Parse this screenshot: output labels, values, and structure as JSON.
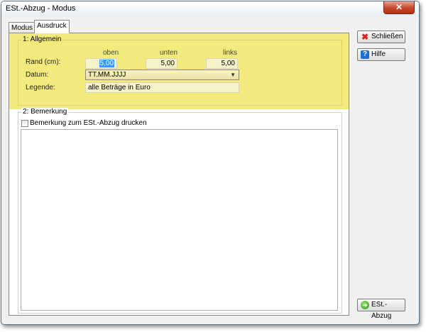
{
  "window": {
    "title": "ESt.-Abzug - Modus",
    "close_glyph": "✕"
  },
  "tabs": [
    {
      "label": "Modus",
      "active": false
    },
    {
      "label": "Ausdruck",
      "active": true
    }
  ],
  "section1": {
    "label": "1: Allgemein",
    "columns": [
      "oben",
      "unten",
      "links"
    ],
    "rand_label": "Rand (cm):",
    "rand_values": [
      "5,00",
      "5,00",
      "5,00"
    ],
    "datum_label": "Datum:",
    "datum_value": "TT.MM.JJJJ",
    "legende_label": "Legende:",
    "legende_value": "alle Beträge in Euro"
  },
  "section2": {
    "label": "2: Bemerkung",
    "checkbox_label": "Bemerkung zum ESt.-Abzug drucken",
    "checked": false,
    "memo_text": ""
  },
  "buttons": {
    "close": {
      "label": "Schließen",
      "icon": "close-x-icon"
    },
    "help": {
      "label": "Hilfe",
      "icon": "help-icon"
    },
    "abzug": {
      "label": "ESt.-Abzug",
      "icon": "go-arrow-icon"
    }
  },
  "colors": {
    "highlight": "#f3ea7e",
    "selection": "#3399ff"
  }
}
